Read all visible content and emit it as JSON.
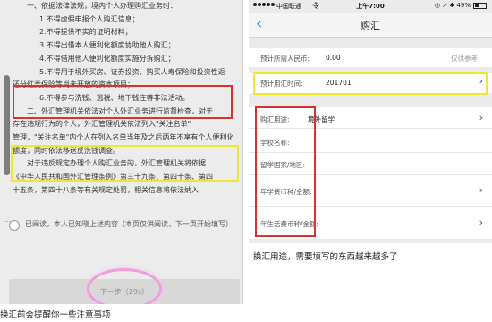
{
  "left_screen": {
    "notice_lines": [
      "一、依据法律法规，境内个人办理购汇业务时：",
      "1.不得虚假申报个人购汇信息；",
      "2.不得提供不实的证明材料；",
      "3.不得出借本人便利化额度协助他人购汇；",
      "4.不得借用他人便利化额度实施分拆购汇；",
      "5.不得用于境外买房、证券投资、购买人寿保险和投资性返",
      "还分红类保险等尚未开放的资本项目；",
      "6.不得参与洗钱、逃税、地下钱庄等非法活动。",
      "二、外汇管理机关依法对个人外汇业务进行监督检查，对于",
      "存在违规行为的个人，外汇管理机关依法列入\"关注名单\"",
      "管理，\"关注名单\"内个人在列入名单当年及之后两年不享有个人便利化",
      "额度，同时依法移送反洗钱调查。",
      "对于违反规定办理个人购汇业务的，外汇管理机关将依据",
      "《中华人民共和国外汇管理条例》第三十九条、第四十条、第四",
      "十五条，第四十八条等有关规定处罚，相关信息将依法纳入"
    ],
    "read_confirm": "已阅读，本人已知晓上述内容（本页仅供阅读，下一页开始填写）",
    "next_button": "下一步（29s）",
    "scroll_dots": "...",
    "caption": "换汇前会提醒你一些注意事项"
  },
  "right_screen": {
    "status_bar": {
      "carrier": "中国联通",
      "wifi": "令",
      "time": "上午7:00",
      "indicators": "◎ ↗ ✱ 49%",
      "battery_percent": 49
    },
    "nav": {
      "back": "‹",
      "title": "购汇"
    },
    "rmb_row": {
      "label": "预计所需人民币:",
      "value": "0.00",
      "hint": "仅供参考"
    },
    "time_row": {
      "label": "预计用汇时间:",
      "value": "201701",
      "chevron": "›"
    },
    "purpose_rows": [
      {
        "label": "购汇用途:",
        "value": "境外留学",
        "chevron": "›"
      },
      {
        "label": "学校名称:",
        "value": "",
        "chevron": ""
      },
      {
        "label": "留学国家/地区:",
        "value": "",
        "chevron": ""
      },
      {
        "label": "年学费币种/金额:",
        "value": "",
        "chevron": "›"
      },
      {
        "label": "年生活费币种/金额:",
        "value": "",
        "chevron": "›"
      }
    ],
    "caption": "换汇用途，需要填写的东西越来越多了"
  },
  "colors": {
    "highlight_red": "#d8322c",
    "highlight_yellow": "#f0e82a",
    "highlight_pink": "#f29cdb",
    "ios_blue": "#2b7de9"
  }
}
